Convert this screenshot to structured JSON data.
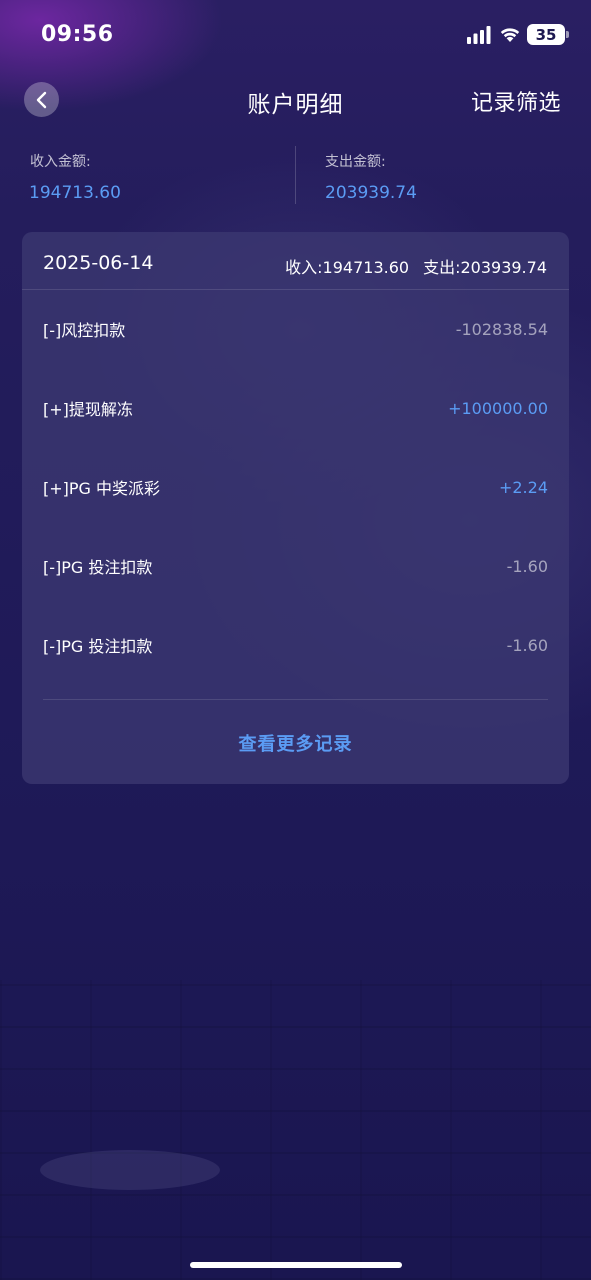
{
  "status_bar": {
    "time": "09:56",
    "battery": "35"
  },
  "nav": {
    "title": "账户明细",
    "filter_label": "记录筛选"
  },
  "summary": {
    "income_label": "收入金额:",
    "income_value": "194713.60",
    "expense_label": "支出金额:",
    "expense_value": "203939.74"
  },
  "card": {
    "date": "2025-06-14",
    "income_total": "收入:194713.60",
    "expense_total": "支出:203939.74",
    "records": [
      {
        "label": "[-]风控扣款",
        "amount": "-102838.54",
        "type": "negative"
      },
      {
        "label": "[+]提现解冻",
        "amount": "+100000.00",
        "type": "positive"
      },
      {
        "label": "[+]PG 中奖派彩",
        "amount": "+2.24",
        "type": "positive"
      },
      {
        "label": "[-]PG 投注扣款",
        "amount": "-1.60",
        "type": "negative"
      },
      {
        "label": "[-]PG 投注扣款",
        "amount": "-1.60",
        "type": "negative"
      }
    ],
    "more_label": "查看更多记录"
  },
  "colors": {
    "accent": "#5b9cf4",
    "negative_amount": "#a8a6c4",
    "card_bg": "#3a3770"
  },
  "icons": {
    "back": "chevron-left-icon",
    "signal": "signal-icon",
    "wifi": "wifi-icon",
    "battery": "battery-icon"
  }
}
